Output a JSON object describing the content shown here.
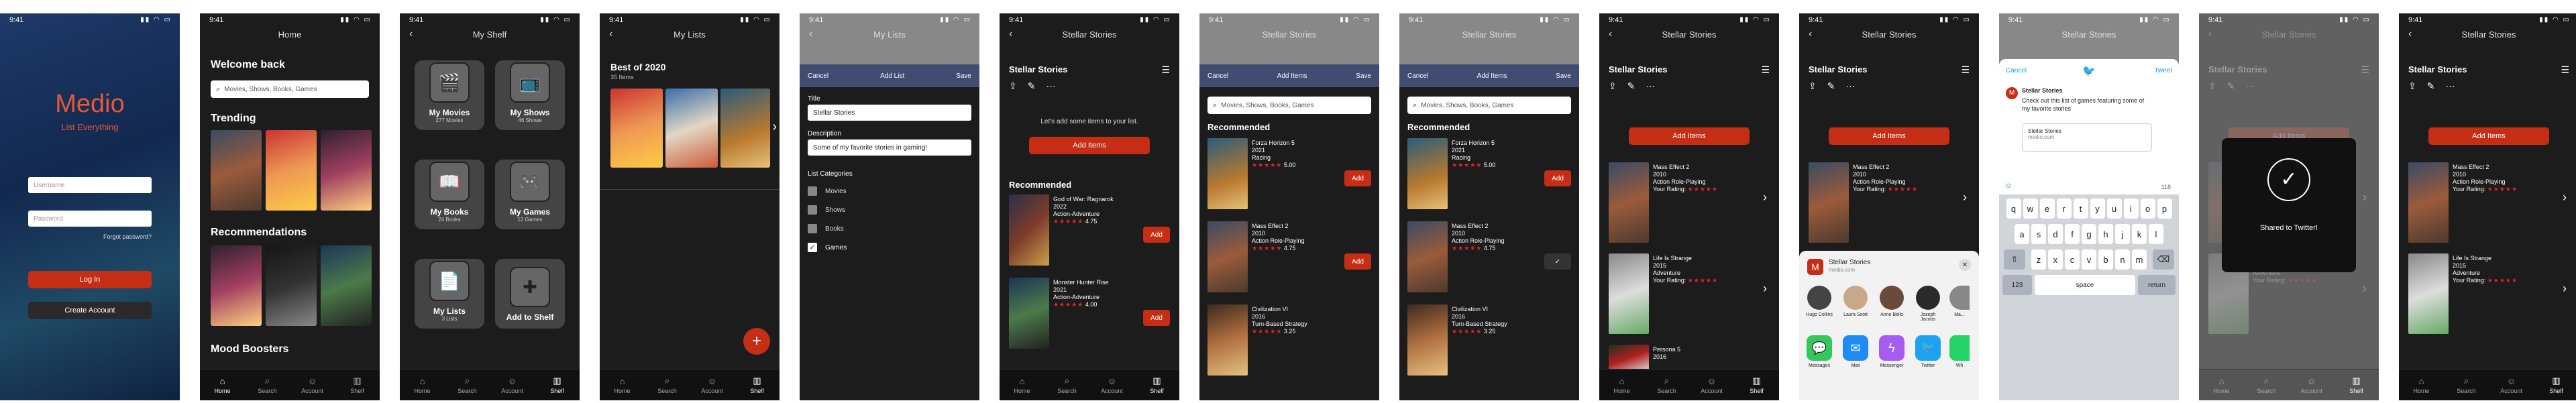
{
  "status": {
    "time": "9:41"
  },
  "splash": {
    "logo": "Medio",
    "tagline": "List Everything",
    "username_ph": "Username",
    "password_ph": "Password",
    "forgot": "Forgot password?",
    "login": "Log In",
    "create": "Create Account"
  },
  "tabs": [
    "Home",
    "Search",
    "Account",
    "Shelf"
  ],
  "home": {
    "title": "Home",
    "welcome": "Welcome back",
    "search_ph": "Movies, Shows, Books, Games",
    "trending": "Trending",
    "recommendations": "Recommendations",
    "mood": "Mood Boosters"
  },
  "shelf": {
    "title": "My Shelf",
    "cards": [
      {
        "title": "My Movies",
        "sub": "277 Movies",
        "icon": "film-icon",
        "glyph": "🎬"
      },
      {
        "title": "My Shows",
        "sub": "46 Shows",
        "icon": "tv-icon",
        "glyph": "📺"
      },
      {
        "title": "My Books",
        "sub": "24 Books",
        "icon": "book-icon",
        "glyph": "📖"
      },
      {
        "title": "My Games",
        "sub": "12 Games",
        "icon": "gamepad-icon",
        "glyph": "🎮"
      },
      {
        "title": "My Lists",
        "sub": "3 Lists",
        "icon": "document-icon",
        "glyph": "📄"
      },
      {
        "title": "Add to Shelf",
        "sub": "",
        "icon": "plus-icon",
        "glyph": "✚"
      }
    ]
  },
  "lists": {
    "title": "My Lists",
    "list_name": "Best of 2020",
    "list_count": "35 Items"
  },
  "addlist": {
    "title": "Add List",
    "cancel": "Cancel",
    "save": "Save",
    "title_label": "Title",
    "title_value": "Stellar Stories",
    "desc_label": "Description",
    "desc_value": "Some of my favorite stories in gaming!",
    "cat_label": "List Categories",
    "categories": [
      "Movies",
      "Shows",
      "Books",
      "Games"
    ]
  },
  "stellar": {
    "title": "Stellar Stories",
    "empty_msg": "Let's add some items to your list.",
    "add_items": "Add Items",
    "recommended": "Recommended",
    "add": "Add"
  },
  "additems": {
    "title": "Add Items",
    "cancel": "Cancel",
    "save": "Save",
    "search_ph": "Movies, Shows, Books, Games"
  },
  "games": [
    {
      "name": "God of War: Ragnarok",
      "year": "2022",
      "genre": "Action-Adventure",
      "rating": "4.75"
    },
    {
      "name": "Monster Hunter Rise",
      "year": "2021",
      "genre": "Action-Adventure",
      "rating": "4.00"
    },
    {
      "name": "Forza Horizon 5",
      "year": "2021",
      "genre": "Racing",
      "rating": "5.00"
    },
    {
      "name": "Mass Effect 2",
      "year": "2010",
      "genre": "Action Role-Playing",
      "rating": "4.75"
    },
    {
      "name": "Civilization VI",
      "year": "2016",
      "genre": "Turn-Based Strategy",
      "rating": "3.25"
    },
    {
      "name": "Life Is Strange",
      "year": "2015",
      "genre": "Adventure",
      "rating": ""
    },
    {
      "name": "Persona 5",
      "year": "2016",
      "genre": "",
      "rating": ""
    }
  ],
  "your_rating": "Your Rating:",
  "share": {
    "site": "medio.com",
    "title": "Stellar Stories",
    "apps": [
      "Messages",
      "Mail",
      "Messenger",
      "Twitter",
      "Wh"
    ],
    "people": [
      "Hugo Collins",
      "Laura Scott",
      "Anne Bello",
      "Joseph Jacobs",
      "Ma..."
    ]
  },
  "tweet": {
    "cancel": "Cancel",
    "tweet": "Tweet",
    "user": "Stellar Stories",
    "text": "Check out this list of games featuring some of my favorite stories",
    "card_title": "Stellar Stories",
    "card_site": "medio.com",
    "count": "118",
    "space": "space",
    "return": "return",
    "numkey": "123"
  },
  "keyboard": {
    "row1": [
      "q",
      "w",
      "e",
      "r",
      "t",
      "y",
      "u",
      "i",
      "o",
      "p"
    ],
    "row2": [
      "a",
      "s",
      "d",
      "f",
      "g",
      "h",
      "j",
      "k",
      "l"
    ],
    "row3": [
      "z",
      "x",
      "c",
      "v",
      "b",
      "n",
      "m"
    ]
  },
  "shared": {
    "msg": "Shared to Twitter!"
  },
  "colors": {
    "accent": "#c52d14",
    "modal": "#404c72",
    "twitter": "#1da1f2"
  }
}
